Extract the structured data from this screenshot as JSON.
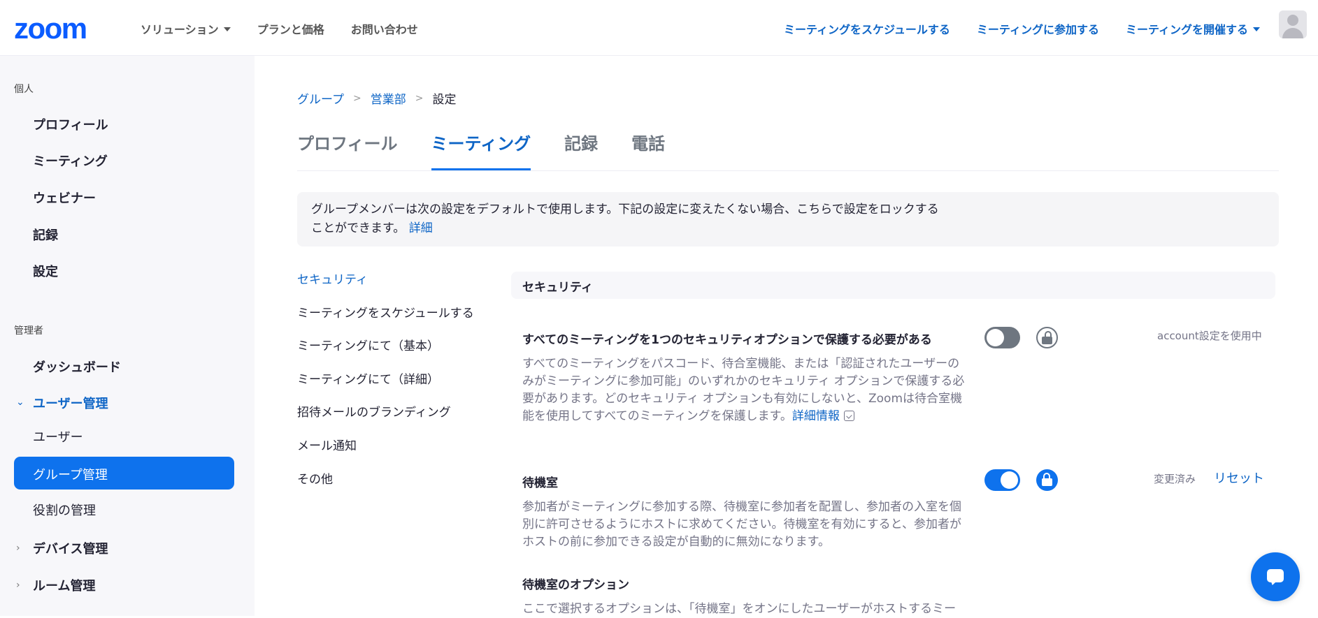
{
  "header": {
    "logo": "zoom",
    "nav_left": [
      "ソリューション",
      "プランと価格",
      "お問い合わせ"
    ],
    "nav_right": [
      "ミーティングをスケジュールする",
      "ミーティングに参加する",
      "ミーティングを開催する"
    ]
  },
  "sidebar": {
    "section_personal": "個人",
    "personal_items": [
      "プロフィール",
      "ミーティング",
      "ウェビナー",
      "記録",
      "設定"
    ],
    "section_admin": "管理者",
    "admin_dashboard": "ダッシュボード",
    "user_mgmt": "ユーザー管理",
    "user_mgmt_children": [
      "ユーザー",
      "グループ管理",
      "役割の管理"
    ],
    "device_mgmt": "デバイス管理",
    "room_mgmt": "ルーム管理"
  },
  "breadcrumb": [
    "グループ",
    "営業部",
    "設定"
  ],
  "tabs": [
    "プロフィール",
    "ミーティング",
    "記録",
    "電話"
  ],
  "notice": {
    "text": "グループメンバーは次の設定をデフォルトで使用します。下記の設定に変えたくない場合、こちらで設定をロックすることができます。",
    "link": "詳細"
  },
  "subnav": [
    "セキュリティ",
    "ミーティングをスケジュールする",
    "ミーティングにて（基本）",
    "ミーティングにて（詳細）",
    "招待メールのブランディング",
    "メール通知",
    "その他"
  ],
  "section_header": "セキュリティ",
  "settings": [
    {
      "title": "すべてのミーティングを1つのセキュリティオプションで保護する必要がある",
      "description": "すべてのミーティングをパスコード、待合室機能、または「認証されたユーザーのみがミーティングに参加可能」のいずれかのセキュリティ オプションで保護する必要があります。どのセキュリティ オプションも有効にしないと、Zoomは待合室機能を使用してすべてのミーティングを保護します。",
      "link": "詳細情報",
      "status": "account設定を使用中",
      "enabled": false,
      "locked": false
    },
    {
      "title": "待機室",
      "description": "参加者がミーティングに参加する際、待機室に参加者を配置し、参加者の入室を個別に許可させるようにホストに求めてください。待機室を有効にすると、参加者がホストの前に参加できる設定が自動的に無効になります。",
      "status": "変更済み",
      "reset": "リセット",
      "enabled": true,
      "locked": true
    },
    {
      "title": "待機室のオプション",
      "description": "ここで選択するオプションは、「待機室」をオンにしたユーザーがホストするミー"
    }
  ],
  "colors": {
    "accent": "#0e72ed",
    "link": "#0e65c6",
    "logo": "#0b5cff"
  }
}
